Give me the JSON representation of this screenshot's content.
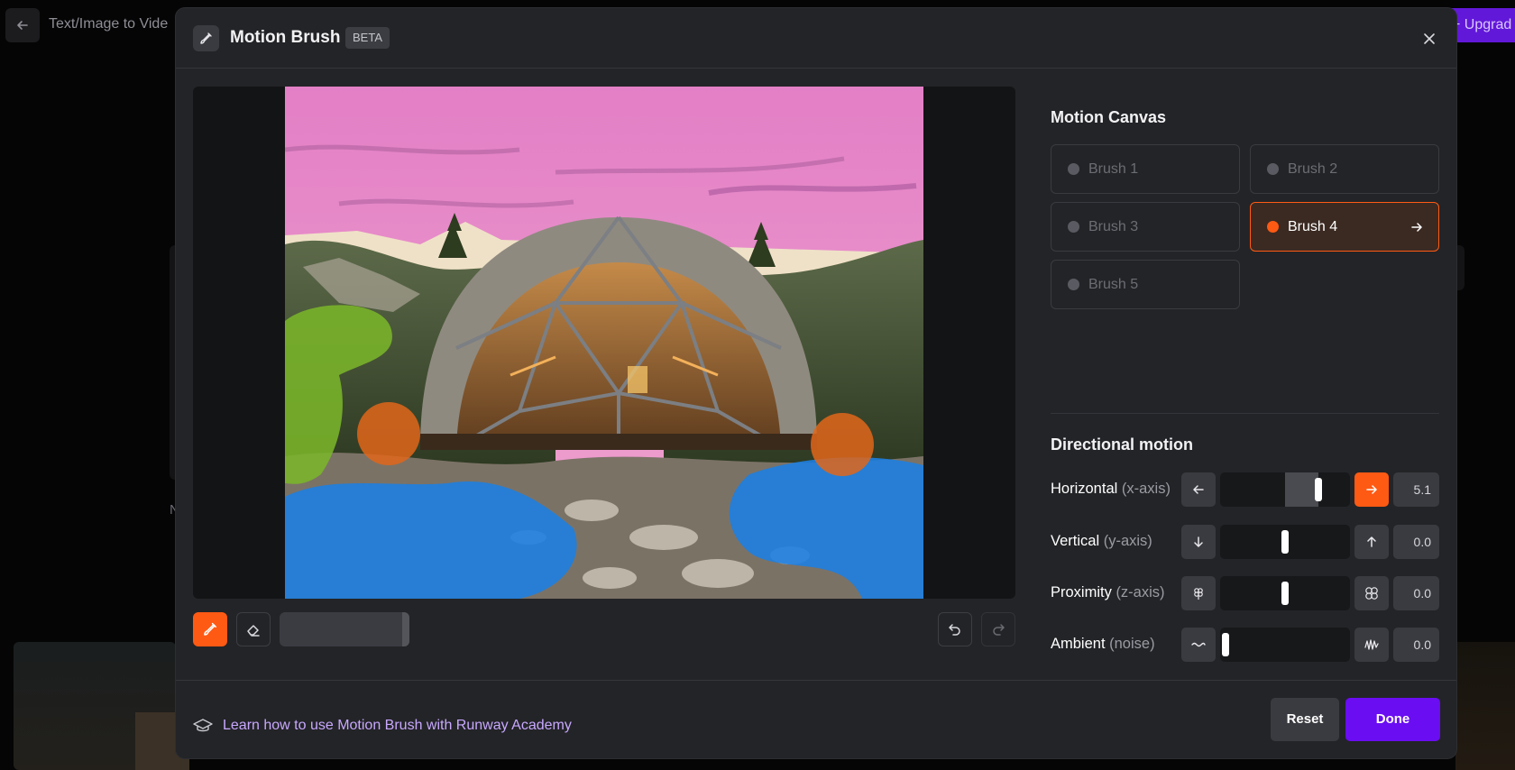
{
  "background": {
    "title": "Text/Image to Vide",
    "upgrade_label": "+ Upgrad",
    "fragment_text": "N"
  },
  "modal": {
    "title": "Motion Brush",
    "badge": "BETA"
  },
  "motion_canvas": {
    "title": "Motion Canvas",
    "brushes": [
      {
        "label": "Brush 1",
        "active": false
      },
      {
        "label": "Brush 2",
        "active": false
      },
      {
        "label": "Brush 3",
        "active": false
      },
      {
        "label": "Brush 4",
        "active": true
      },
      {
        "label": "Brush 5",
        "active": false
      }
    ]
  },
  "directional_motion": {
    "title": "Directional motion",
    "controls": [
      {
        "label": "Horizontal",
        "axis": "(x-axis)",
        "value": "5.1",
        "neg_icon": "arrow-left-icon",
        "pos_icon": "arrow-right-icon"
      },
      {
        "label": "Vertical",
        "axis": "(y-axis)",
        "value": "0.0",
        "neg_icon": "arrow-down-icon",
        "pos_icon": "arrow-up-icon"
      },
      {
        "label": "Proximity",
        "axis": "(z-axis)",
        "value": "0.0",
        "neg_icon": "flower-small-icon",
        "pos_icon": "flower-large-icon"
      },
      {
        "label": "Ambient",
        "axis": "(noise)",
        "value": "0.0",
        "neg_icon": "wave-low-icon",
        "pos_icon": "wave-high-icon"
      }
    ]
  },
  "footer": {
    "learn_text": "Learn how to use Motion Brush with Runway Academy",
    "reset_label": "Reset",
    "done_label": "Done"
  },
  "colors": {
    "accent_orange": "#ff5a14",
    "done_purple": "#6a0df2",
    "learn_link": "#c8a8ff",
    "mask_green": "#7ab52a",
    "mask_blue": "#1e7fe0",
    "mask_orange": "#e0661a"
  }
}
